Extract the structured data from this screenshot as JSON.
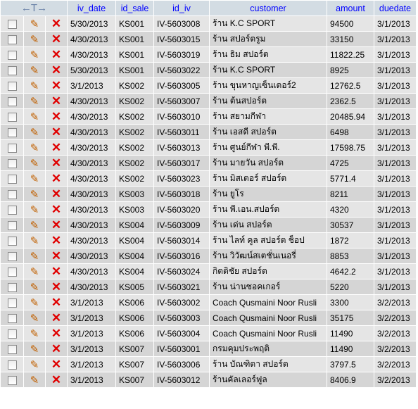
{
  "header": {
    "arrows_label": "←T→",
    "columns": [
      "iv_date",
      "id_sale",
      "id_iv",
      "customer",
      "amount",
      "duedate"
    ]
  },
  "colors": {
    "header_bg": "#d3dce3",
    "header_text": "#0000ff",
    "row_odd": "#e5e5e5",
    "row_even": "#d5d5d5",
    "delete_icon": "#e00000"
  },
  "icons": {
    "edit": "pencil-icon",
    "delete": "delete-x-icon",
    "select": "checkbox"
  },
  "rows": [
    [
      "5/30/2013",
      "KS001",
      "IV-5603008",
      "ร้าน K.C SPORT",
      "94500",
      "3/1/2013"
    ],
    [
      "4/30/2013",
      "KS001",
      "IV-5603015",
      "ร้าน สปอร์ตรูม",
      "33150",
      "3/1/2013"
    ],
    [
      "4/30/2013",
      "KS001",
      "IV-5603019",
      "ร้าน ธิม สปอร์ต",
      "11822.25",
      "3/1/2013"
    ],
    [
      "5/30/2013",
      "KS001",
      "IV-5603022",
      "ร้าน K.C SPORT",
      "8925",
      "3/1/2013"
    ],
    [
      "3/1/2013",
      "KS002",
      "IV-5603005",
      "ร้าน ขุนหาญเซ็นเตอร์2",
      "12762.5",
      "3/1/2013"
    ],
    [
      "4/30/2013",
      "KS002",
      "IV-5603007",
      "ร้าน ต้นสปอร์ต",
      "2362.5",
      "3/1/2013"
    ],
    [
      "4/30/2013",
      "KS002",
      "IV-5603010",
      "ร้าน สยามกีฬา",
      "20485.94",
      "3/1/2013"
    ],
    [
      "4/30/2013",
      "KS002",
      "IV-5603011",
      "ร้าน เอสดี สปอร์ต",
      "6498",
      "3/1/2013"
    ],
    [
      "4/30/2013",
      "KS002",
      "IV-5603013",
      "ร้าน ศูนย์กีฬา พี.พี.",
      "17598.75",
      "3/1/2013"
    ],
    [
      "4/30/2013",
      "KS002",
      "IV-5603017",
      "ร้าน มายวัน สปอร์ต",
      "4725",
      "3/1/2013"
    ],
    [
      "4/30/2013",
      "KS002",
      "IV-5603023",
      "ร้าน มิสเตอร์ สปอร์ต",
      "5771.4",
      "3/1/2013"
    ],
    [
      "4/30/2013",
      "KS003",
      "IV-5603018",
      "ร้าน ยูโร",
      "8211",
      "3/1/2013"
    ],
    [
      "4/30/2013",
      "KS003",
      "IV-5603020",
      "ร้าน พี.เอน.สปอร์ต",
      "4320",
      "3/1/2013"
    ],
    [
      "4/30/2013",
      "KS004",
      "IV-5603009",
      "ร้าน เด่น สปอร์ต",
      "30537",
      "3/1/2013"
    ],
    [
      "4/30/2013",
      "KS004",
      "IV-5603014",
      "ร้าน ไลท์ คูล สปอร์ต ช็อป",
      "1872",
      "3/1/2013"
    ],
    [
      "4/30/2013",
      "KS004",
      "IV-5603016",
      "ร้าน วิวัฒน์สเตชั่นเนอรี่",
      "8853",
      "3/1/2013"
    ],
    [
      "4/30/2013",
      "KS004",
      "IV-5603024",
      "กิตติชัย สปอร์ต",
      "4642.2",
      "3/1/2013"
    ],
    [
      "4/30/2013",
      "KS005",
      "IV-5603021",
      "ร้าน น่านซอคเกอร์",
      "5220",
      "3/1/2013"
    ],
    [
      "3/1/2013",
      "KS006",
      "IV-5603002",
      "Coach Qusmaini Noor Rusli",
      "3300",
      "3/2/2013"
    ],
    [
      "3/1/2013",
      "KS006",
      "IV-5603003",
      "Coach Qusmaini Noor Rusli",
      "35175",
      "3/2/2013"
    ],
    [
      "3/1/2013",
      "KS006",
      "IV-5603004",
      "Coach Qusmaini Noor Rusli",
      "11490",
      "3/2/2013"
    ],
    [
      "3/1/2013",
      "KS007",
      "IV-5603001",
      "กรมคุมประพฤติ",
      "11490",
      "3/2/2013"
    ],
    [
      "3/1/2013",
      "KS007",
      "IV-5603006",
      "ร้าน บัณฑิตา สปอร์ต",
      "3797.5",
      "3/2/2013"
    ],
    [
      "3/1/2013",
      "KS007",
      "IV-5603012",
      "ร้านคัลเลอร์ฟูล",
      "8406.9",
      "3/2/2013"
    ]
  ]
}
